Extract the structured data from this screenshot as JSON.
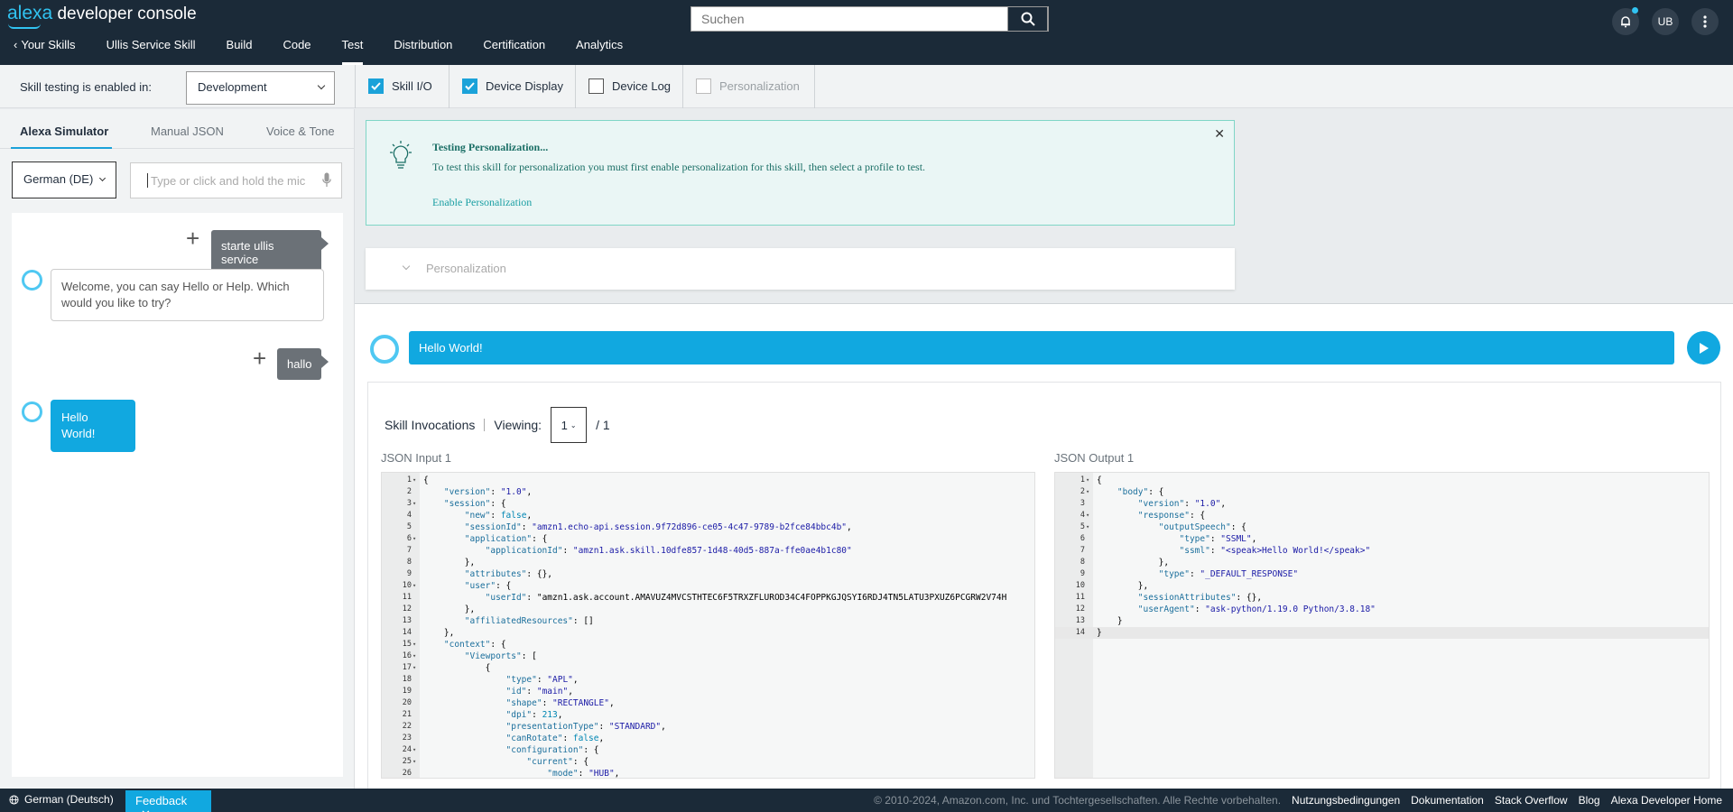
{
  "header": {
    "logo_alexa": "alexa",
    "logo_rest": "developer console",
    "search_placeholder": "Suchen",
    "user_initials": "UB"
  },
  "nav": {
    "back": "Your Skills",
    "items": [
      "Ullis Service Skill",
      "Build",
      "Code",
      "Test",
      "Distribution",
      "Certification",
      "Analytics"
    ],
    "active": "Test"
  },
  "toolbar": {
    "label": "Skill testing is enabled in:",
    "stage": "Development",
    "checks": [
      {
        "label": "Skill I/O",
        "checked": true,
        "disabled": false
      },
      {
        "label": "Device Display",
        "checked": true,
        "disabled": false
      },
      {
        "label": "Device Log",
        "checked": false,
        "disabled": false
      },
      {
        "label": "Personalization",
        "checked": false,
        "disabled": true
      }
    ]
  },
  "left": {
    "tabs": [
      "Alexa Simulator",
      "Manual JSON",
      "Voice & Tone"
    ],
    "language": "German (DE)",
    "utterance_placeholder": "Type or click and hold the mic",
    "conversation": [
      {
        "role": "user",
        "text": "starte ullis service"
      },
      {
        "role": "alexa",
        "text": "Welcome, you can say Hello or Help. Which would you like to try?"
      },
      {
        "role": "user",
        "text": "hallo"
      },
      {
        "role": "alexa",
        "text": "Hello World!"
      }
    ]
  },
  "personalization_box": {
    "title": "Testing Personalization...",
    "desc": "To test this skill for personalization you must first enable personalization for this skill, then select a profile to test.",
    "link": "Enable Personalization",
    "collapse_label": "Personalization"
  },
  "speech": {
    "text": "Hello World!"
  },
  "invocations": {
    "title": "Skill Invocations",
    "viewing_label": "Viewing:",
    "viewing_value": "1",
    "viewing_total": "/ 1",
    "input_label": "JSON Input 1",
    "output_label": "JSON Output 1",
    "input_lines": [
      "{",
      "    \"version\": \"1.0\",",
      "    \"session\": {",
      "        \"new\": false,",
      "        \"sessionId\": \"amzn1.echo-api.session.9f72d896-ce05-4c47-9789-b2fce84bbc4b\",",
      "        \"application\": {",
      "            \"applicationId\": \"amzn1.ask.skill.10dfe857-1d48-40d5-887a-ffe0ae4b1c80\"",
      "        },",
      "        \"attributes\": {},",
      "        \"user\": {",
      "            \"userId\": \"amzn1.ask.account.AMAVUZ4MVCSTHTEC6F5TRXZFLUROD34C4FOPPKGJQSYI6RDJ4TN5LATU3PXUZ6PCGRW2V74H",
      "        },",
      "        \"affiliatedResources\": []",
      "    },",
      "    \"context\": {",
      "        \"Viewports\": [",
      "            {",
      "                \"type\": \"APL\",",
      "                \"id\": \"main\",",
      "                \"shape\": \"RECTANGLE\",",
      "                \"dpi\": 213,",
      "                \"presentationType\": \"STANDARD\",",
      "                \"canRotate\": false,",
      "                \"configuration\": {",
      "                    \"current\": {",
      "                        \"mode\": \"HUB\","
    ],
    "input_folds": [
      1,
      3,
      6,
      10,
      15,
      16,
      17,
      24,
      25
    ],
    "output_lines": [
      "{",
      "    \"body\": {",
      "        \"version\": \"1.0\",",
      "        \"response\": {",
      "            \"outputSpeech\": {",
      "                \"type\": \"SSML\",",
      "                \"ssml\": \"<speak>Hello World!</speak>\"",
      "            },",
      "            \"type\": \"_DEFAULT_RESPONSE\"",
      "        },",
      "        \"sessionAttributes\": {},",
      "        \"userAgent\": \"ask-python/1.19.0 Python/3.8.18\"",
      "    }",
      "}"
    ],
    "output_folds": [
      1,
      2,
      4,
      5
    ]
  },
  "footer": {
    "language": "German (Deutsch)",
    "feedback": "Feedback",
    "copyright": "© 2010-2024, Amazon.com, Inc. und Tochtergesellschaften. Alle Rechte vorbehalten.",
    "links": [
      "Nutzungsbedingungen",
      "Dokumentation",
      "Stack Overflow",
      "Blog",
      "Alexa Developer Home"
    ]
  },
  "colors": {
    "accent": "#11a8e0",
    "header": "#1b2a38",
    "teal": "#1b6f66"
  }
}
